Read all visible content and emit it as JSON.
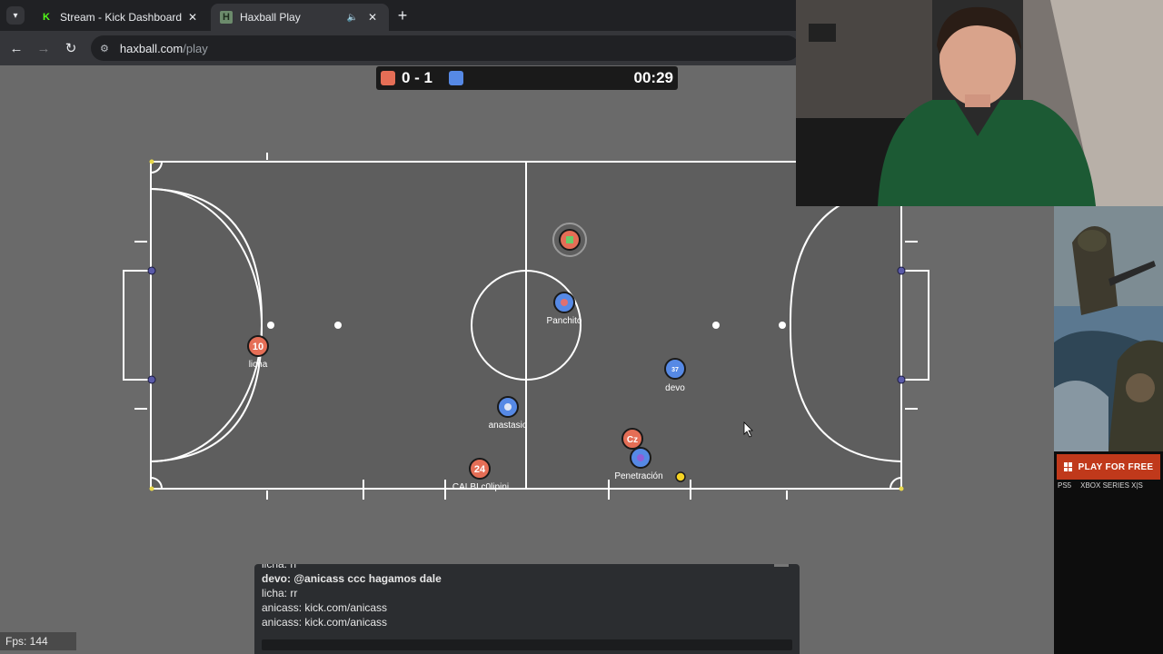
{
  "browser": {
    "tabs": [
      {
        "title": "Stream - Kick Dashboard",
        "favicon": "kick-icon",
        "active": false
      },
      {
        "title": "Haxball Play",
        "favicon": "haxball-icon",
        "active": true
      }
    ],
    "url_host": "haxball.com",
    "url_path": "/play"
  },
  "scoreboard": {
    "score": "0 - 1",
    "time": "00:29",
    "red_color": "#e56e56",
    "blue_color": "#5689e5"
  },
  "players": [
    {
      "name": "licha",
      "team": "red",
      "avatar": "10"
    },
    {
      "name": "Panchito",
      "team": "blue",
      "avatar": ""
    },
    {
      "name": "devo",
      "team": "blue",
      "avatar": "37"
    },
    {
      "name": "anastasio",
      "team": "blue",
      "avatar": ""
    },
    {
      "name": "CALBI c0lipini",
      "team": "red",
      "avatar": "24"
    },
    {
      "name": "",
      "team": "red",
      "avatar": "Cz"
    },
    {
      "name": "Penetración",
      "team": "blue",
      "avatar": ""
    },
    {
      "name": "",
      "team": "red",
      "avatar": ""
    }
  ],
  "chat": {
    "lines": [
      {
        "text": "licha: rr",
        "bold": false
      },
      {
        "text": "devo: @anicass ccc hagamos dale",
        "bold": true
      },
      {
        "text": "licha: rr",
        "bold": false
      },
      {
        "text": "anicass: kick.com/anicass",
        "bold": false
      },
      {
        "text": "anicass: kick.com/anicass",
        "bold": false
      }
    ]
  },
  "fps": "Fps: 144",
  "ad": {
    "cta": "PLAY FOR FREE",
    "platforms": [
      "PS5",
      "XBOX SERIES X|S"
    ]
  }
}
